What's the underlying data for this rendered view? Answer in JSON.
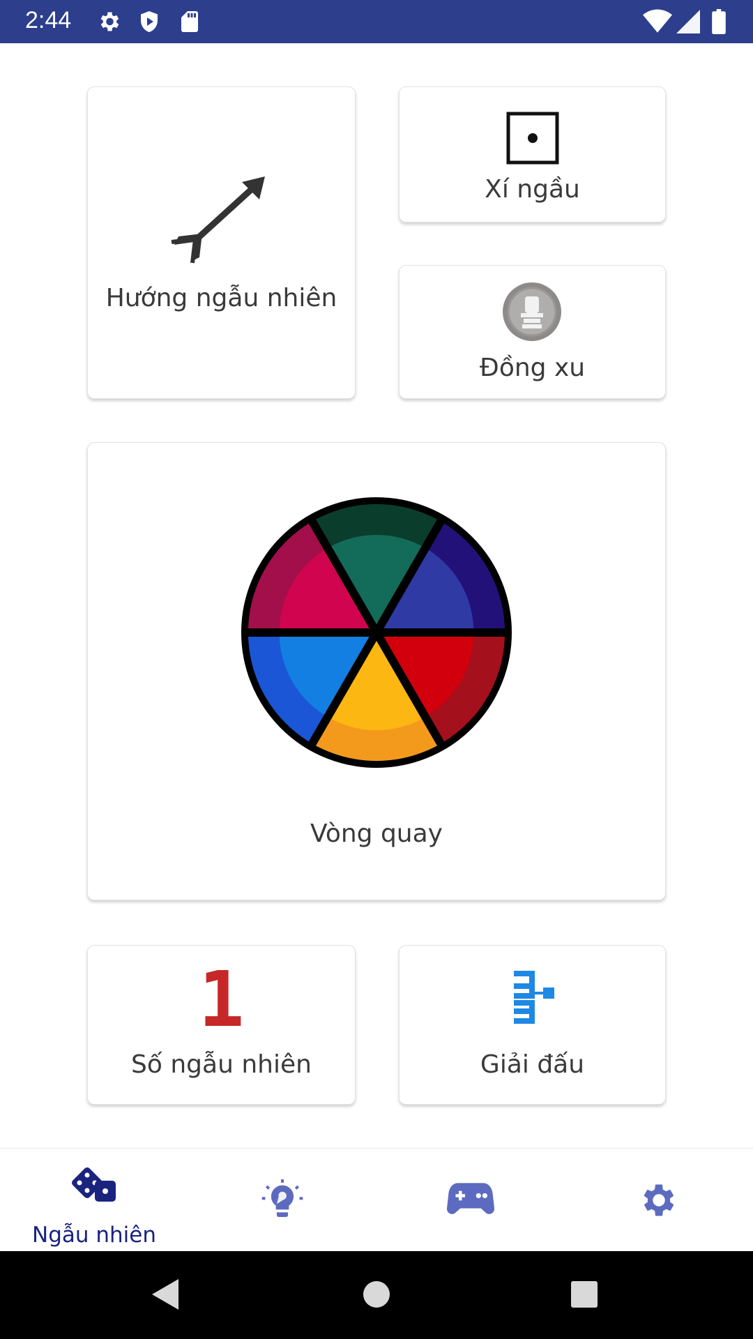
{
  "status_bar": {
    "time": "2:44",
    "icons": [
      "gear-icon",
      "shield-icon",
      "sd-card-icon",
      "wifi-icon",
      "signal-icon",
      "battery-icon"
    ]
  },
  "cards": {
    "direction": {
      "label": "Hướng ngẫu nhiên",
      "icon": "arrow-icon"
    },
    "dice": {
      "label": "Xí ngầu",
      "icon": "dice-one-icon"
    },
    "coin": {
      "label": "Đồng xu",
      "icon": "coin-icon"
    },
    "wheel": {
      "label": "Vòng quay",
      "icon": "spinning-wheel-icon"
    },
    "number": {
      "label": "Số ngẫu nhiên",
      "glyph": "1",
      "icon": "number-one-icon"
    },
    "tournament": {
      "label": "Giải đấu",
      "icon": "tournament-bracket-icon"
    }
  },
  "bottom_nav": {
    "items": [
      {
        "label": "Ngẫu nhiên",
        "icon": "dice-icon",
        "active": true
      },
      {
        "label": "",
        "icon": "lightbulb-icon",
        "active": false
      },
      {
        "label": "",
        "icon": "gamepad-icon",
        "active": false
      },
      {
        "label": "",
        "icon": "gear-icon",
        "active": false
      }
    ]
  },
  "colors": {
    "status_bar": "#2c3e8c",
    "nav_active": "#1a237e",
    "nav_inactive": "#5c6bc0",
    "number_red": "#c62828",
    "tournament_blue": "#1e88e5"
  }
}
